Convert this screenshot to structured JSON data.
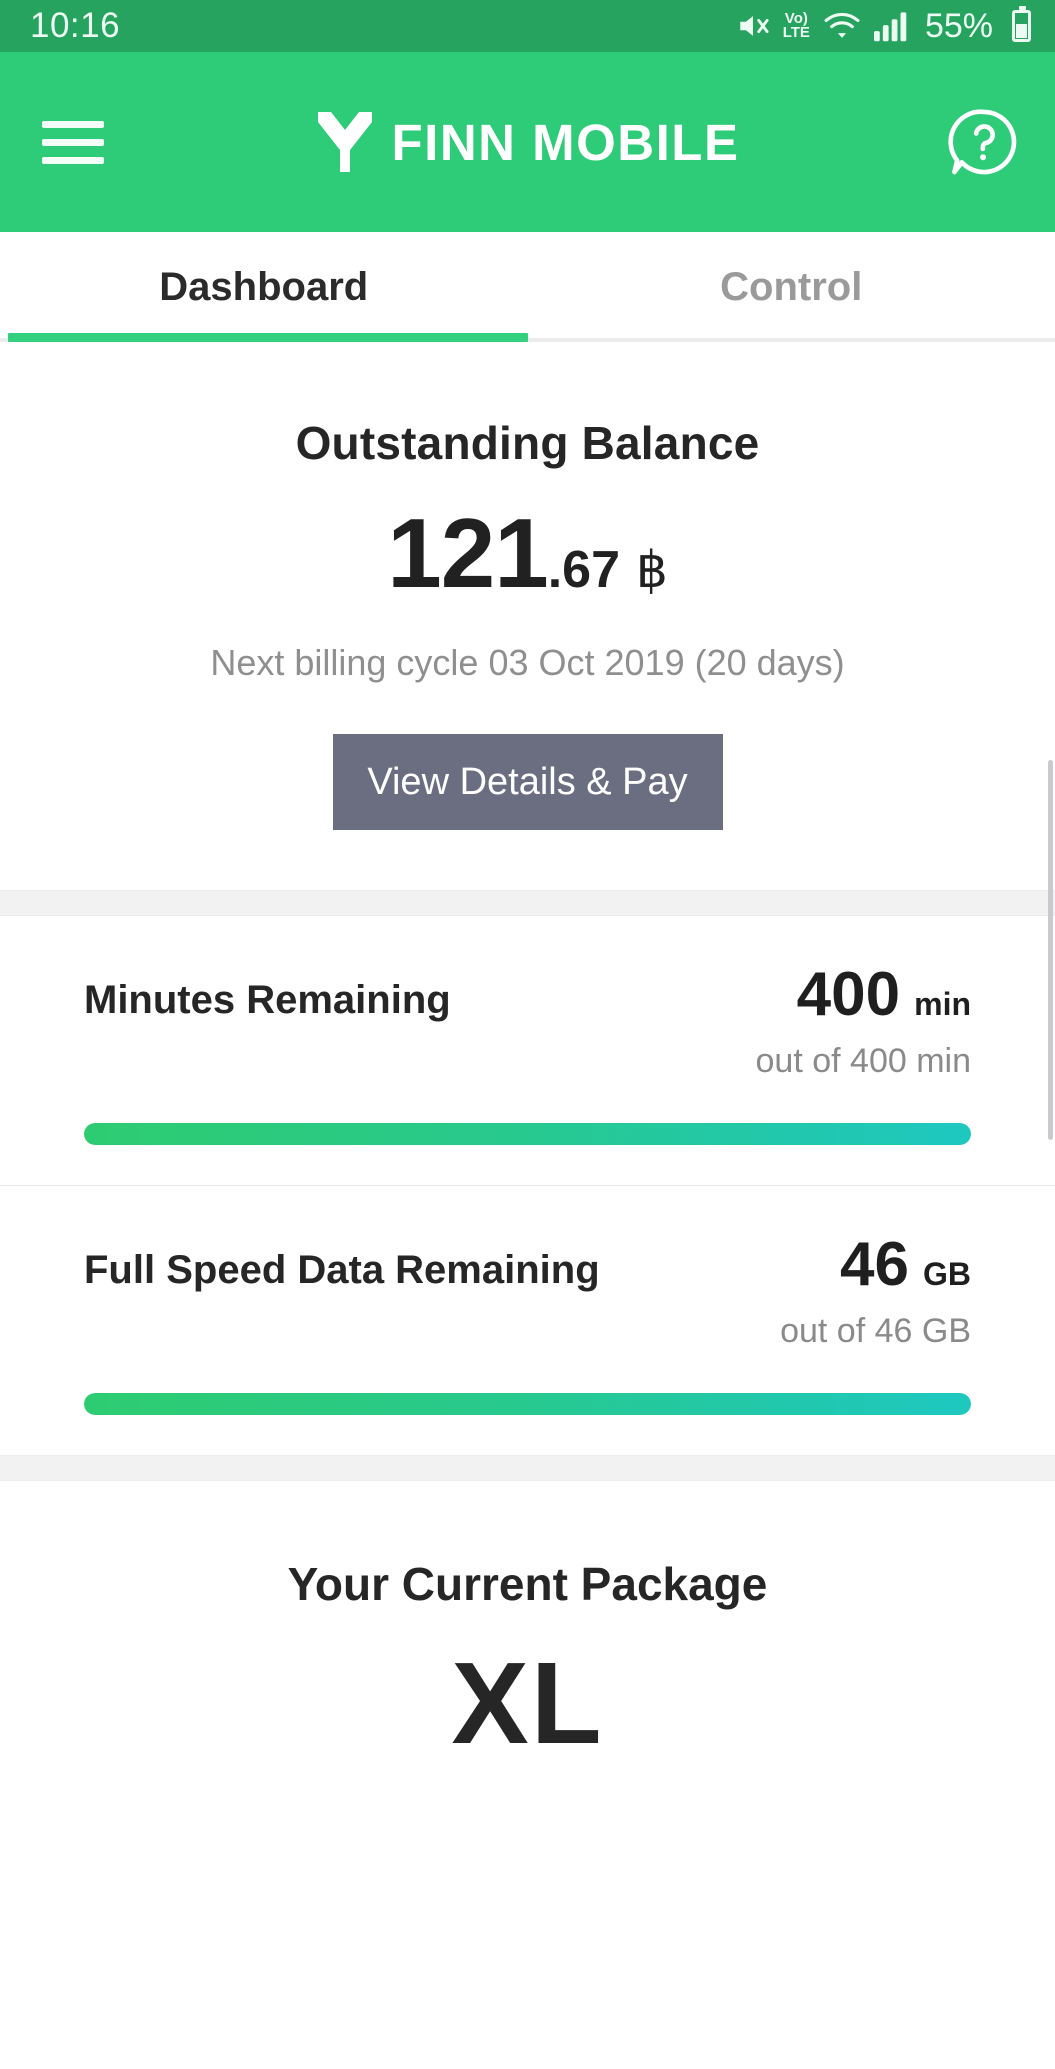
{
  "status_bar": {
    "time": "10:16",
    "network_type": "Vo) LTE",
    "volte_top": "Vo)",
    "volte_bottom": "LTE",
    "battery_percent": "55%",
    "icons": [
      "mute-icon",
      "volte-icon",
      "wifi-icon",
      "signal-icon",
      "battery-icon"
    ]
  },
  "app_bar": {
    "title": "FINN MOBILE",
    "menu_icon": "hamburger-menu-icon",
    "help_icon": "help-question-icon",
    "brand_color": "#2ecc78"
  },
  "tabs": [
    {
      "label": "Dashboard",
      "active": true
    },
    {
      "label": "Control",
      "active": false
    }
  ],
  "balance": {
    "title": "Outstanding Balance",
    "amount_integer": "121",
    "amount_decimal": ".67",
    "currency_symbol": "฿",
    "billing_note": "Next billing cycle 03 Oct 2019 (20 days)",
    "button_label": "View Details & Pay",
    "button_color": "#6a6e80"
  },
  "usage": [
    {
      "label": "Minutes Remaining",
      "value": "400",
      "unit": "min",
      "total_text": "out of 400 min",
      "progress_percent": 100
    },
    {
      "label": "Full Speed Data Remaining",
      "value": "46",
      "unit": "GB",
      "total_text": "out of 46 GB",
      "progress_percent": 100
    }
  ],
  "package": {
    "title": "Your Current Package",
    "name": "XL"
  },
  "colors": {
    "accent_green": "#2ecc78",
    "status_bar_green": "#25a35f",
    "progress_start": "#2ecc71",
    "progress_end": "#1ec8c0",
    "text_dark": "#262626",
    "text_muted": "#8f8f8f"
  }
}
